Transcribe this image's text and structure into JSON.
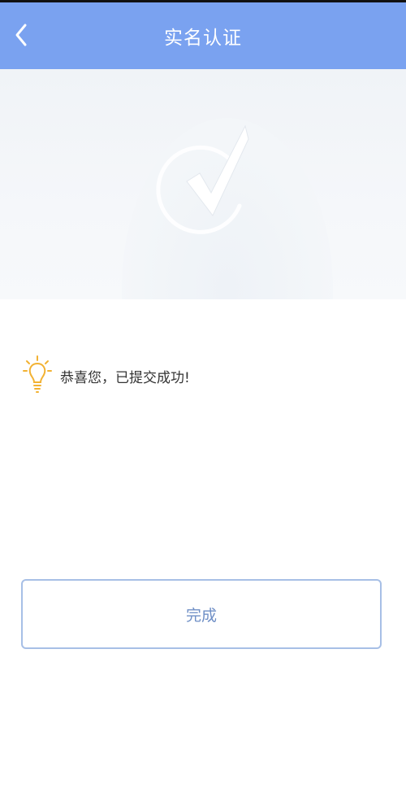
{
  "header": {
    "title": "实名认证",
    "back_icon": "chevron-left-icon",
    "background_color": "#7aa2f0"
  },
  "hero": {
    "graphic_icon": "checkmark-circle-icon"
  },
  "message": {
    "icon": "lightbulb-icon",
    "icon_color": "#f2b233",
    "text": "恭喜您，已提交成功!"
  },
  "actions": {
    "done_label": "完成",
    "done_border_color": "#a7bfe6",
    "done_text_color": "#6f8fc6"
  }
}
